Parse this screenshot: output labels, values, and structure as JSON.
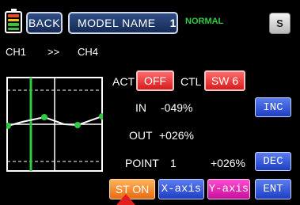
{
  "header": {
    "back_label": "BACK",
    "model_name_label": "MODEL NAME",
    "model_number": "1",
    "mode_status": "NORMAL",
    "system_label": "S",
    "battery_icon": "battery-icon"
  },
  "channels": {
    "source": "CH1",
    "arrow": ">>",
    "target": "CH4"
  },
  "controls": {
    "act_label": "ACT",
    "act_value": "OFF",
    "ctl_label": "CTL",
    "ctl_value": "SW 6",
    "in_label": "IN",
    "in_value": "-049%",
    "out_label": "OUT",
    "out_value": "+026%",
    "point_label": "POINT",
    "point_number": "1",
    "point_value": "+026%",
    "inc_label": "INC",
    "dec_label": "DEC",
    "ent_label": "ENT",
    "st_on_label": "ST ON",
    "x_axis_label": "X-axis",
    "y_axis_label": "Y-axis"
  },
  "colors": {
    "status_green": "#2ecc40",
    "curve_green": "#2ecc40",
    "act_red": "#e02020",
    "axis_magenta": "#e020b8",
    "axis_blue": "#2f55e0",
    "st_orange": "#f08a30"
  }
}
